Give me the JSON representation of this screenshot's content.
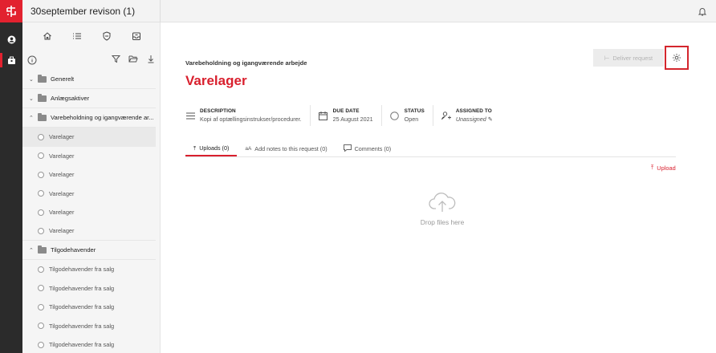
{
  "colors": {
    "accent": "#e2222f",
    "rail": "#2b2b2b",
    "sidebar_bg": "#f5f5f5"
  },
  "topbar": {
    "title": "30september revison (1)"
  },
  "sidebar": {
    "tree": [
      {
        "type": "folder",
        "expanded": false,
        "label": "Generelt"
      },
      {
        "type": "folder",
        "expanded": false,
        "label": "Anlægsaktiver"
      },
      {
        "type": "folder",
        "expanded": true,
        "label": "Varebeholdning og igangværende ar..."
      },
      {
        "type": "request",
        "label": "Varelager",
        "selected": true
      },
      {
        "type": "request",
        "label": "Varelager"
      },
      {
        "type": "request",
        "label": "Varelager"
      },
      {
        "type": "request",
        "label": "Varelager"
      },
      {
        "type": "request",
        "label": "Varelager"
      },
      {
        "type": "request",
        "label": "Varelager"
      },
      {
        "type": "folder",
        "expanded": true,
        "label": "Tilgodehavender"
      },
      {
        "type": "request",
        "label": "Tilgodehavender fra salg"
      },
      {
        "type": "request",
        "label": "Tilgodehavender fra salg"
      },
      {
        "type": "request",
        "label": "Tilgodehavender fra salg"
      },
      {
        "type": "request",
        "label": "Tilgodehavender fra salg"
      },
      {
        "type": "request",
        "label": "Tilgodehavender fra salg"
      }
    ]
  },
  "main": {
    "breadcrumb": "Varebeholdning og igangværende arbejde",
    "title": "Varelager",
    "deliver_label": "Deliver request",
    "meta": {
      "description": {
        "label": "DESCRIPTION",
        "value": "Kopi af optællingsinstrukser/procedurer."
      },
      "due_date": {
        "label": "DUE DATE",
        "value": "25 August 2021"
      },
      "status": {
        "label": "STATUS",
        "value": "Open"
      },
      "assigned": {
        "label": "ASSIGNED TO",
        "value": "Unassigned"
      }
    },
    "tabs": [
      {
        "label": "Uploads (0)",
        "active": true
      },
      {
        "label": "Add notes to this request (0)"
      },
      {
        "label": "Comments (0)"
      }
    ],
    "upload_label": "Upload",
    "drop_text": "Drop files here"
  }
}
